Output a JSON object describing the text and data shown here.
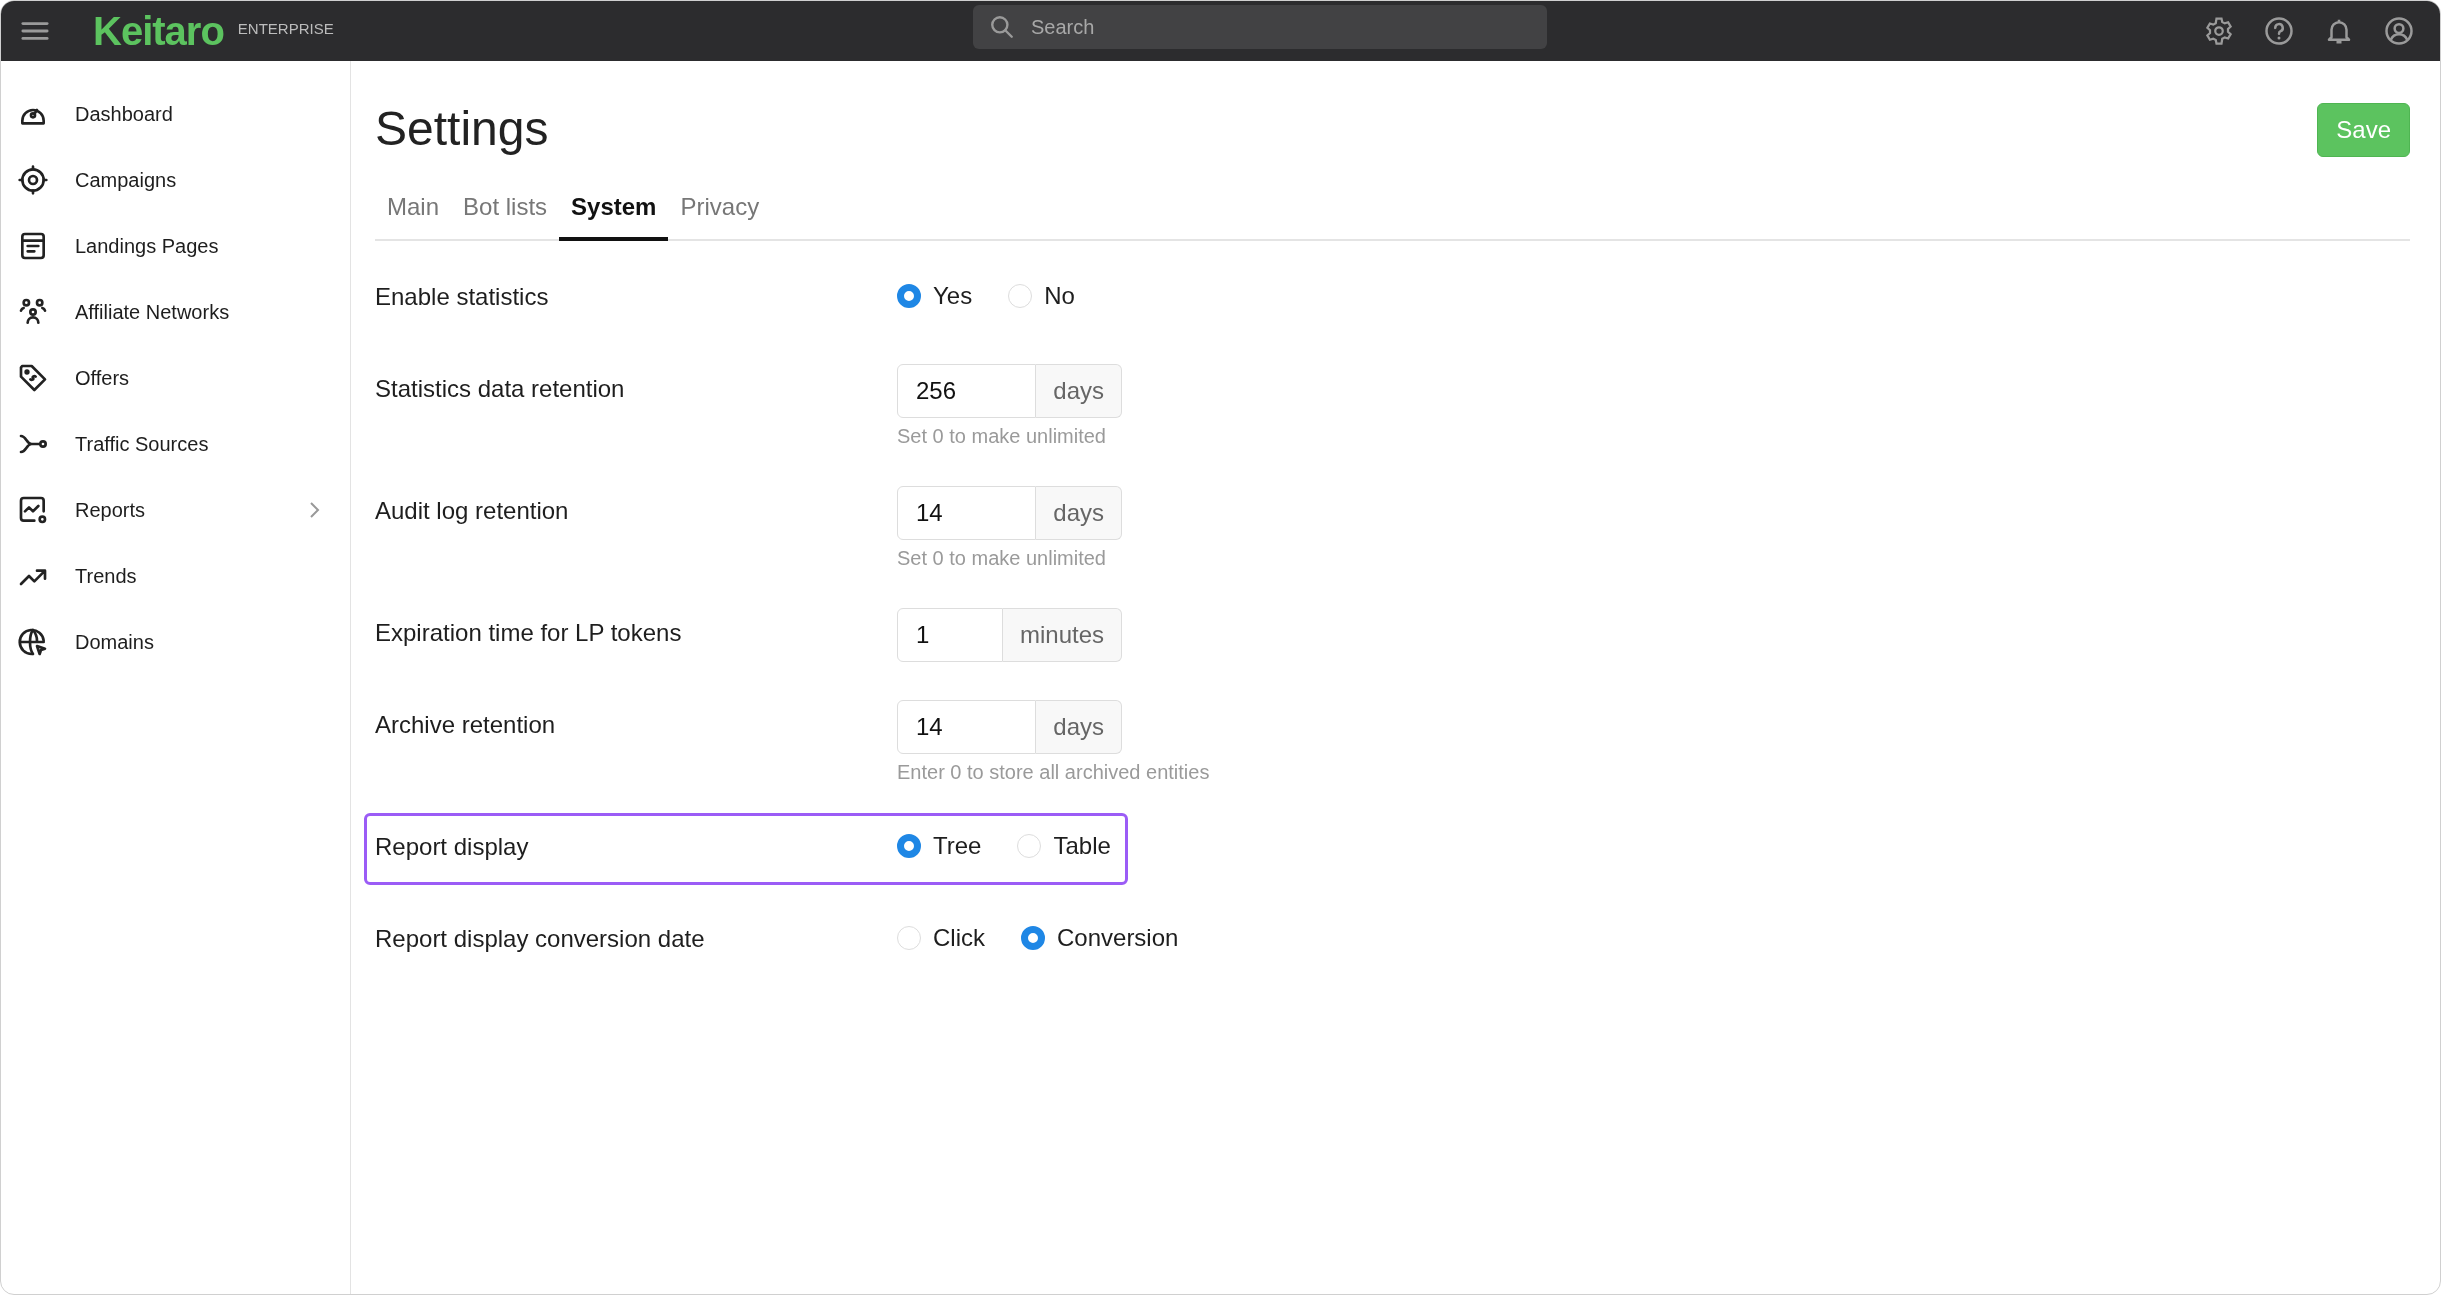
{
  "topbar": {
    "logo": "Keitaro",
    "edition": "ENTERPRISE",
    "search": {
      "placeholder": "Search"
    }
  },
  "sidebar": {
    "items": [
      {
        "label": "Dashboard",
        "expandable": false
      },
      {
        "label": "Campaigns",
        "expandable": false
      },
      {
        "label": "Landings Pages",
        "expandable": false
      },
      {
        "label": "Affiliate Networks",
        "expandable": false
      },
      {
        "label": "Offers",
        "expandable": false
      },
      {
        "label": "Traffic Sources",
        "expandable": false
      },
      {
        "label": "Reports",
        "expandable": true
      },
      {
        "label": "Trends",
        "expandable": false
      },
      {
        "label": "Domains",
        "expandable": false
      }
    ]
  },
  "page": {
    "title": "Settings",
    "save_button": "Save"
  },
  "tabs": [
    {
      "label": "Main",
      "selected": false
    },
    {
      "label": "Bot lists",
      "selected": false
    },
    {
      "label": "System",
      "selected": true
    },
    {
      "label": "Privacy",
      "selected": false
    }
  ],
  "rows": [
    {
      "kind": "radio",
      "label": "Enable statistics",
      "highlighted": false,
      "options": [
        {
          "label": "Yes",
          "selected": true
        },
        {
          "label": "No",
          "selected": false
        }
      ]
    },
    {
      "kind": "input",
      "label": "Statistics data retention",
      "highlighted": false,
      "value": "256",
      "unit": "days",
      "hint": "Set 0 to make unlimited"
    },
    {
      "kind": "input",
      "label": "Audit log retention",
      "highlighted": false,
      "value": "14",
      "unit": "days",
      "hint": "Set 0 to make unlimited"
    },
    {
      "kind": "input",
      "label": "Expiration time for LP tokens",
      "highlighted": false,
      "value": "1",
      "unit": "minutes"
    },
    {
      "kind": "input",
      "label": "Archive retention",
      "highlighted": false,
      "value": "14",
      "unit": "days",
      "hint": "Enter 0 to store all archived entities"
    },
    {
      "kind": "radio",
      "label": "Report display",
      "highlighted": true,
      "options": [
        {
          "label": "Tree",
          "selected": true
        },
        {
          "label": "Table",
          "selected": false
        }
      ]
    },
    {
      "kind": "radio",
      "label": "Report display conversion date",
      "highlighted": false,
      "options": [
        {
          "label": "Click",
          "selected": false
        },
        {
          "label": "Conversion",
          "selected": true
        }
      ]
    }
  ]
}
